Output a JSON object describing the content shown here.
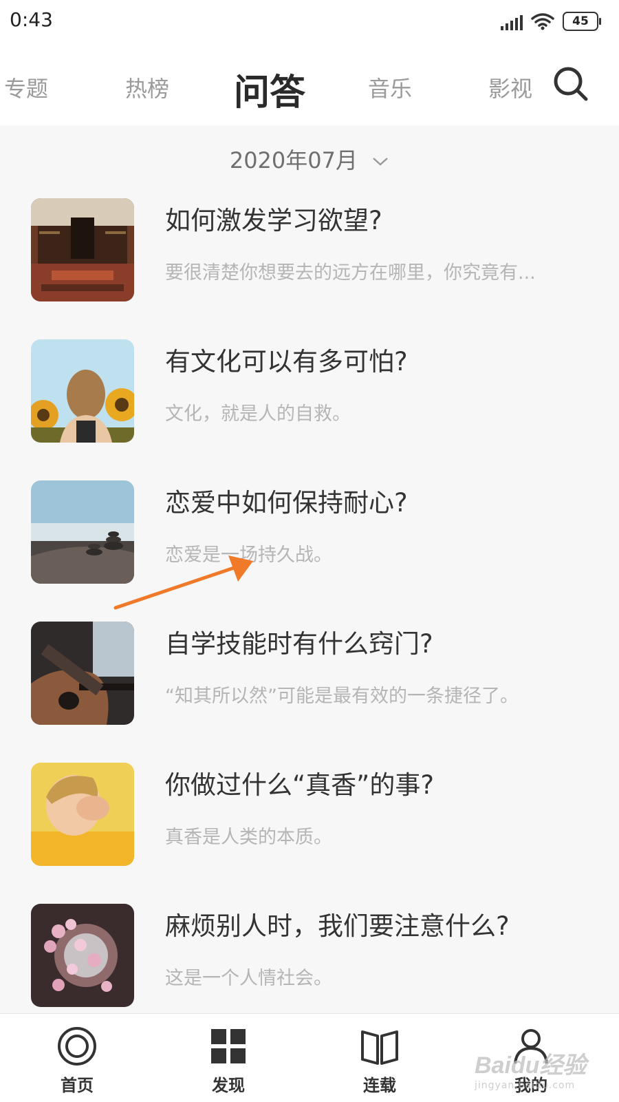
{
  "status_bar": {
    "time": "0:43",
    "battery": "45"
  },
  "tabs": [
    {
      "label": "专题",
      "active": false
    },
    {
      "label": "热榜",
      "active": false
    },
    {
      "label": "问答",
      "active": true
    },
    {
      "label": "音乐",
      "active": false
    },
    {
      "label": "影视",
      "active": false
    }
  ],
  "date_selector": {
    "label": "2020年07月"
  },
  "questions": [
    {
      "title": "如何激发学习欲望?",
      "desc": "要很清楚你想要去的远方在哪里，你究竟有..."
    },
    {
      "title": "有文化可以有多可怕?",
      "desc": "文化，就是人的自救。"
    },
    {
      "title": "恋爱中如何保持耐心?",
      "desc": "恋爱是一场持久战。"
    },
    {
      "title": "自学技能时有什么窍门?",
      "desc": "“知其所以然”可能是最有效的一条捷径了。"
    },
    {
      "title": "你做过什么“真香”的事?",
      "desc": "真香是人类的本质。"
    },
    {
      "title": "麻烦别人时，我们要注意什么?",
      "desc": "这是一个人情社会。"
    }
  ],
  "bottom_nav": [
    {
      "label": "首页",
      "icon": "home-circle-icon"
    },
    {
      "label": "发现",
      "icon": "grid-icon"
    },
    {
      "label": "连载",
      "icon": "book-icon"
    },
    {
      "label": "我的",
      "icon": "user-icon"
    }
  ],
  "watermark": {
    "logo": "Baidu经验",
    "sub": "jingyan.baidu.com"
  },
  "colors": {
    "annotation_arrow": "#f07a2a",
    "title": "#333333",
    "desc": "#b5b5b5"
  }
}
